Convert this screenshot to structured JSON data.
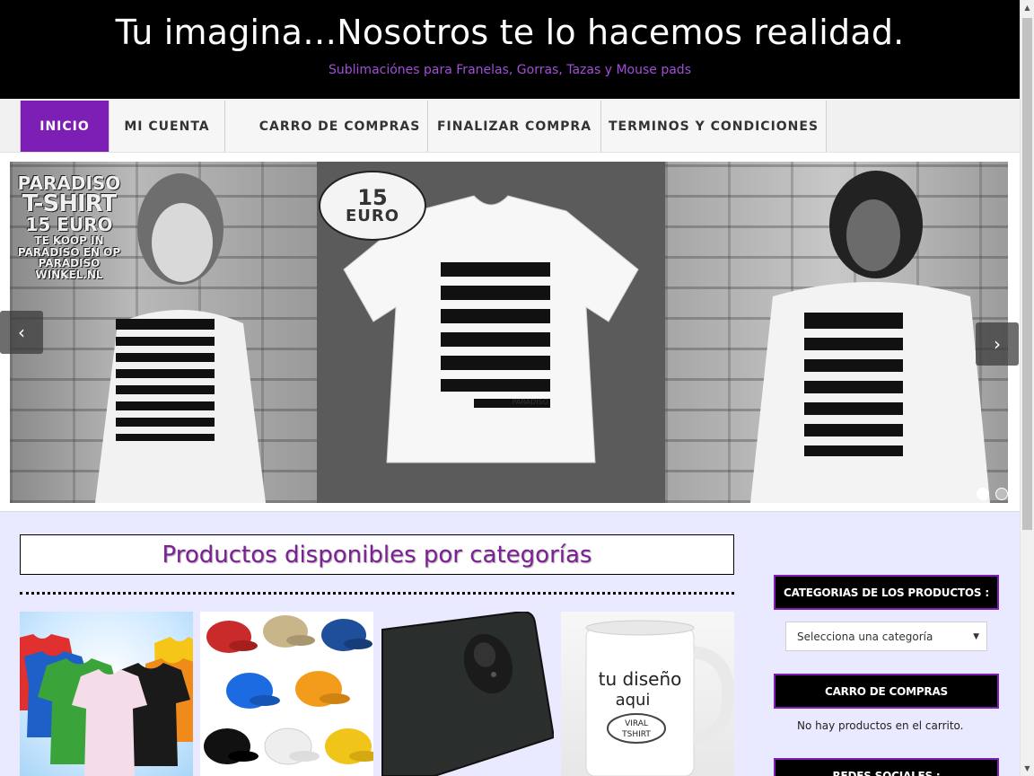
{
  "header": {
    "title": "Tu imagina…Nosotros te lo hacemos realidad.",
    "tagline": "Sublimaciónes para Franelas, Gorras, Tazas y Mouse pads"
  },
  "nav": {
    "items": [
      {
        "label": "INICIO",
        "active": true
      },
      {
        "label": "MI CUENTA",
        "active": false
      },
      {
        "label": "CARRO DE COMPRAS",
        "active": false
      },
      {
        "label": "FINALIZAR COMPRA",
        "active": false
      },
      {
        "label": "TERMINOS Y CONDICIONES",
        "active": false
      }
    ]
  },
  "slider": {
    "promo_lines": [
      "PARADISO",
      "T-SHIRT",
      "15 EURO",
      "TE KOOP IN PARADISO EN OP PARADISO WINKEL.NL"
    ],
    "price_badge": {
      "amount": "15",
      "currency": "EURO"
    },
    "shirt_brand": "PARADISO",
    "prev_icon": "‹",
    "next_icon": "›",
    "active_slide": 1,
    "slide_count": 2
  },
  "main": {
    "section_heading": "Productos disponibles por categorías",
    "products": [
      {
        "name": "franelas",
        "image": "tshirts-image"
      },
      {
        "name": "gorras",
        "image": "caps-image"
      },
      {
        "name": "mouse-pads",
        "image": "mousepad-image"
      },
      {
        "name": "tazas",
        "image": "mug-image",
        "mug_text": [
          "tu diseño",
          "aqui"
        ],
        "mug_badge": [
          "VIRAL",
          "TSHIRT"
        ]
      }
    ]
  },
  "sidebar": {
    "categories_title": "CATEGORIAS DE LOS PRODUCTOS :",
    "category_select_value": "Selecciona una categoría",
    "cart_title": "CARRO DE COMPRAS",
    "cart_empty_text": "No hay productos en el carrito.",
    "social_title": "REDES SOCIALES :"
  },
  "colors": {
    "accent": "#7d1fb4",
    "header_bg": "#000000",
    "content_bg": "#e9e9ff",
    "heading_text": "#7d1f96"
  }
}
